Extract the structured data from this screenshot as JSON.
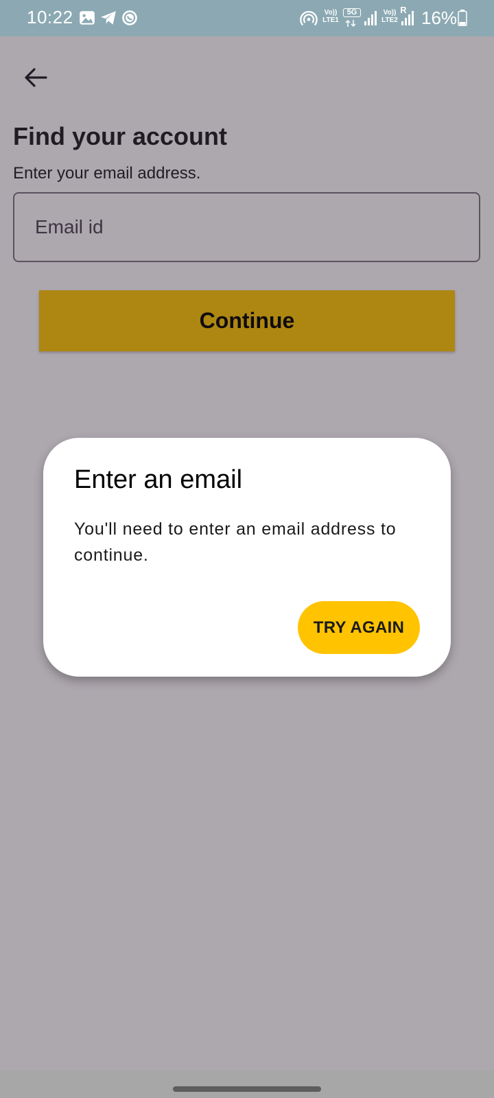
{
  "status_bar": {
    "time": "10:22",
    "notification_icons": [
      "gallery-icon",
      "telegram-icon",
      "whatsapp-icon"
    ],
    "sim1_label": "Vo)) LTE1",
    "network_type": "5G",
    "sim2_label": "Vo)) LTE2",
    "roaming_indicator": "R",
    "battery_percent": "16%",
    "background_color": "#8ca9b3"
  },
  "page": {
    "title": "Find your account",
    "subtitle": "Enter your email address.",
    "email_field": {
      "value": "",
      "placeholder": "Email id"
    },
    "continue_label": "Continue",
    "continue_color": "#ffc800"
  },
  "dialog": {
    "title": "Enter an email",
    "message": "You'll need to enter an email address to continue.",
    "action_label": "TRY AGAIN",
    "action_color": "#ffc300"
  }
}
